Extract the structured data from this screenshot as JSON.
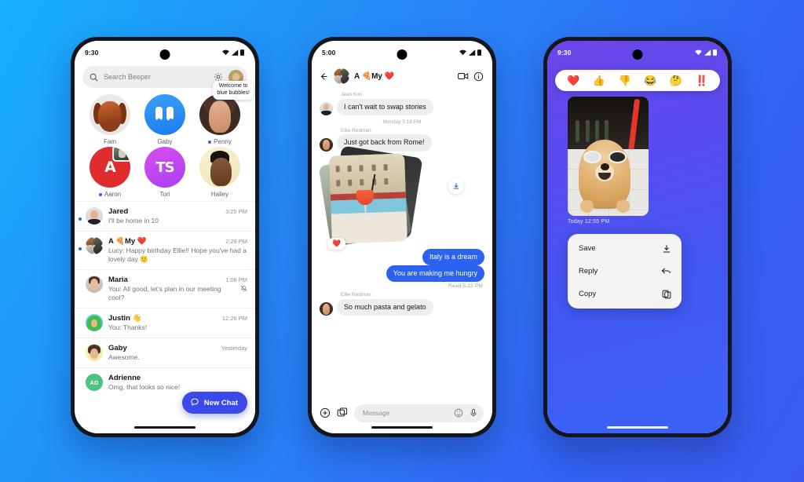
{
  "background": {
    "from": "#17b0fb",
    "to": "#3b5bf0"
  },
  "phone1": {
    "status": {
      "time": "9:30"
    },
    "search": {
      "placeholder": "Search Beeper"
    },
    "pinned": [
      {
        "name": "Fam",
        "unread": false
      },
      {
        "name": "Gaby",
        "unread": false
      },
      {
        "name": "Penny",
        "unread": true,
        "tooltip_line1": "Welcome to",
        "tooltip_line2": "blue bubbles!"
      },
      {
        "name": "Aaron",
        "unread": true,
        "initials": "A"
      },
      {
        "name": "Tori",
        "unread": false,
        "initials": "TS"
      },
      {
        "name": "Hailey",
        "unread": false
      }
    ],
    "chats": [
      {
        "name": "Jared",
        "time": "3:25 PM",
        "preview": "I'll be home in 10",
        "unread": true,
        "muted": false
      },
      {
        "name": "A 🍕My ❤️",
        "time": "2:29 PM",
        "preview": "Lucy: Happy birthday Ellie!! Hope you've had a lovely day  🙂",
        "unread": true,
        "muted": false
      },
      {
        "name": "Maria",
        "time": "1:08 PM",
        "preview": "You: All good, let's plan in our meeting cool?",
        "unread": false,
        "muted": true
      },
      {
        "name": "Justin 👋",
        "time": "12:26 PM",
        "preview": "You: Thanks!",
        "unread": false,
        "muted": false
      },
      {
        "name": "Gaby",
        "time": "Yesterday",
        "preview": "Awesome.",
        "unread": false,
        "muted": false
      },
      {
        "name": "Adrienne",
        "time": "",
        "preview": "Omg, that looks so nice!",
        "unread": false,
        "muted": false,
        "initials": "AD"
      }
    ],
    "fab": {
      "label": "New Chat",
      "color": "#3b49e8"
    }
  },
  "phone2": {
    "status": {
      "time": "5:00"
    },
    "header": {
      "title": "A 🍕My ❤️"
    },
    "messages": [
      {
        "type": "incoming",
        "sender": "Jean Kim",
        "text": "I can't wait to swap stories"
      },
      {
        "type": "daystamp",
        "text": "Monday 5:18 PM"
      },
      {
        "type": "incoming",
        "sender": "Ellie Redman",
        "text": "Just got back from Rome!"
      },
      {
        "type": "photo",
        "reactions": "❤️"
      },
      {
        "type": "outgoing",
        "text": "Italy is a dream"
      },
      {
        "type": "outgoing",
        "text": "You are making me hungry"
      },
      {
        "type": "readstamp",
        "text": "Read  5:23 PM"
      },
      {
        "type": "incoming",
        "sender": "Ellie Redman",
        "text": "So much pasta and gelato"
      }
    ],
    "input": {
      "placeholder": "Message"
    },
    "bubble_out_color": "#2b63f0"
  },
  "phone3": {
    "status": {
      "time": "9:30"
    },
    "reactions": [
      "❤️",
      "👍",
      "👎",
      "😂",
      "🤔",
      "‼️"
    ],
    "photo_timestamp": "Today  12:55 PM",
    "menu": [
      {
        "label": "Save",
        "icon": "download-icon"
      },
      {
        "label": "Reply",
        "icon": "reply-arrow-icon"
      },
      {
        "label": "Copy",
        "icon": "copy-icon"
      }
    ]
  }
}
